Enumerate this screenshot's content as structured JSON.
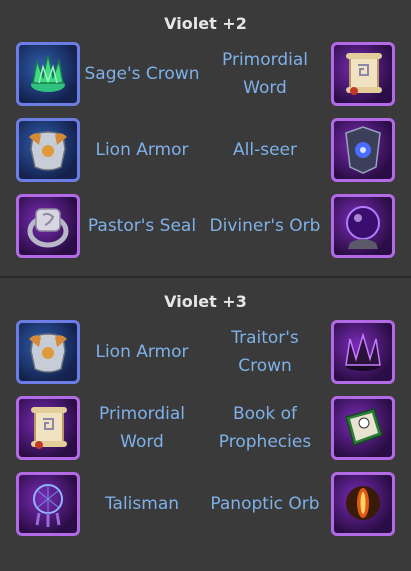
{
  "sections": [
    {
      "title": "Violet +2",
      "rows": [
        {
          "left": {
            "name": "Sage's Crown",
            "icon": "green-crown-icon",
            "color": "blue"
          },
          "right": {
            "name": "Primordial Word",
            "icon": "scroll-icon",
            "color": "violet"
          }
        },
        {
          "left": {
            "name": "Lion Armor",
            "icon": "armor-icon",
            "color": "blue"
          },
          "right": {
            "name": "All-seer",
            "icon": "all-seer-icon",
            "color": "violet"
          }
        },
        {
          "left": {
            "name": "Pastor's Seal",
            "icon": "seal-ring-icon",
            "color": "violet"
          },
          "right": {
            "name": "Diviner's Orb",
            "icon": "orb-icon",
            "color": "violet"
          }
        }
      ]
    },
    {
      "title": "Violet +3",
      "rows": [
        {
          "left": {
            "name": "Lion Armor",
            "icon": "armor-icon",
            "color": "blue"
          },
          "right": {
            "name": "Traitor's Crown",
            "icon": "dark-crown-icon",
            "color": "violet"
          }
        },
        {
          "left": {
            "name": "Primordial Word",
            "icon": "scroll-icon",
            "color": "violet"
          },
          "right": {
            "name": "Book of Prophecies",
            "icon": "book-icon",
            "color": "violet"
          }
        },
        {
          "left": {
            "name": "Talisman",
            "icon": "dreamcatcher-icon",
            "color": "violet"
          },
          "right": {
            "name": "Panoptic Orb",
            "icon": "fiery-orb-icon",
            "color": "violet"
          }
        }
      ]
    }
  ],
  "colors": {
    "background": "#3a3a3a",
    "title": "#e6e6e6",
    "item_label": "#7fb1e8",
    "blue_frame": "#6c7ee6",
    "violet_frame": "#b36ae6"
  }
}
